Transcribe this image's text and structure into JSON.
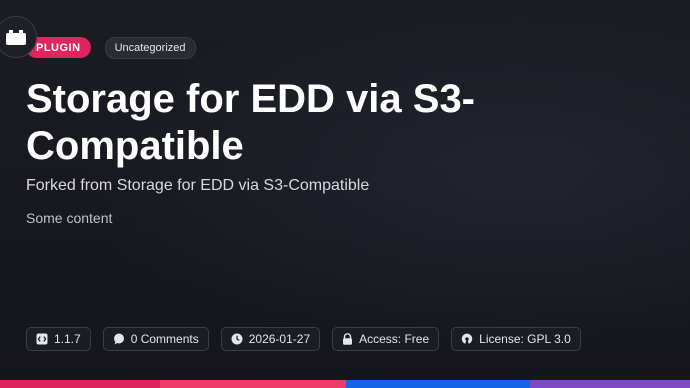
{
  "icon": "plugin-block-icon",
  "tags": {
    "type_label": "PLUGIN",
    "category_label": "Uncategorized"
  },
  "title": "Storage for EDD via S3-Compatible",
  "subtitle": "Forked from Storage for EDD via S3-Compatible",
  "content": "Some content",
  "meta": {
    "version": "1.1.7",
    "comments": "0 Comments",
    "date": "2026-01-27",
    "access": "Access: Free",
    "license": "License: GPL 3.0"
  },
  "colors": {
    "background": "#16171d",
    "badge_accent": "#e0245e",
    "bar_segments": [
      "#e0245e",
      "#f03a6a",
      "#1565e6",
      "#7d49c8"
    ]
  }
}
